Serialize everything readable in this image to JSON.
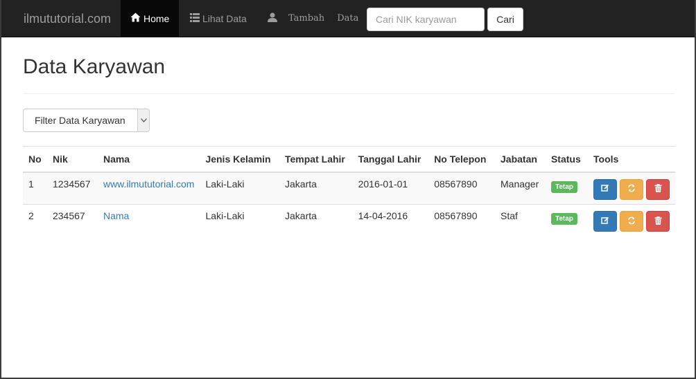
{
  "navbar": {
    "brand": "ilmututorial.com",
    "home_label": "Home",
    "lihat_label": "Lihat Data",
    "tambah_word1": "Tambah",
    "tambah_word2": "Data",
    "search_placeholder": "Cari NIK karyawan",
    "search_button": "Cari"
  },
  "page": {
    "title": "Data Karyawan",
    "filter_label": "Filter Data Karyawan"
  },
  "table": {
    "headers": [
      "No",
      "Nik",
      "Nama",
      "Jenis Kelamin",
      "Tempat Lahir",
      "Tanggal Lahir",
      "No Telepon",
      "Jabatan",
      "Status",
      "Tools"
    ],
    "rows": [
      {
        "no": "1",
        "nik": "1234567",
        "nama": "www.ilmututorial.com",
        "jenis_kelamin": "Laki-Laki",
        "tempat_lahir": "Jakarta",
        "tanggal_lahir": "2016-01-01",
        "telepon": "08567890",
        "jabatan": "Manager",
        "status": "Tetap"
      },
      {
        "no": "2",
        "nik": "234567",
        "nama": "Nama",
        "jenis_kelamin": "Laki-Laki",
        "tempat_lahir": "Jakarta",
        "tanggal_lahir": "14-04-2016",
        "telepon": "08567890",
        "jabatan": "Staf",
        "status": "Tetap"
      }
    ]
  },
  "colors": {
    "navbar_bg": "#222222",
    "link": "#337ab7",
    "status_badge": "#5cb85c",
    "edit_button": "#337ab7",
    "refresh_button": "#f0ad4e",
    "delete_button": "#d9534f"
  },
  "icons": {
    "home": "home-icon",
    "list": "list-icon",
    "user": "user-icon",
    "edit": "edit-icon",
    "refresh": "refresh-icon",
    "delete": "trash-icon",
    "select_arrow": "chevron-down-icon"
  }
}
